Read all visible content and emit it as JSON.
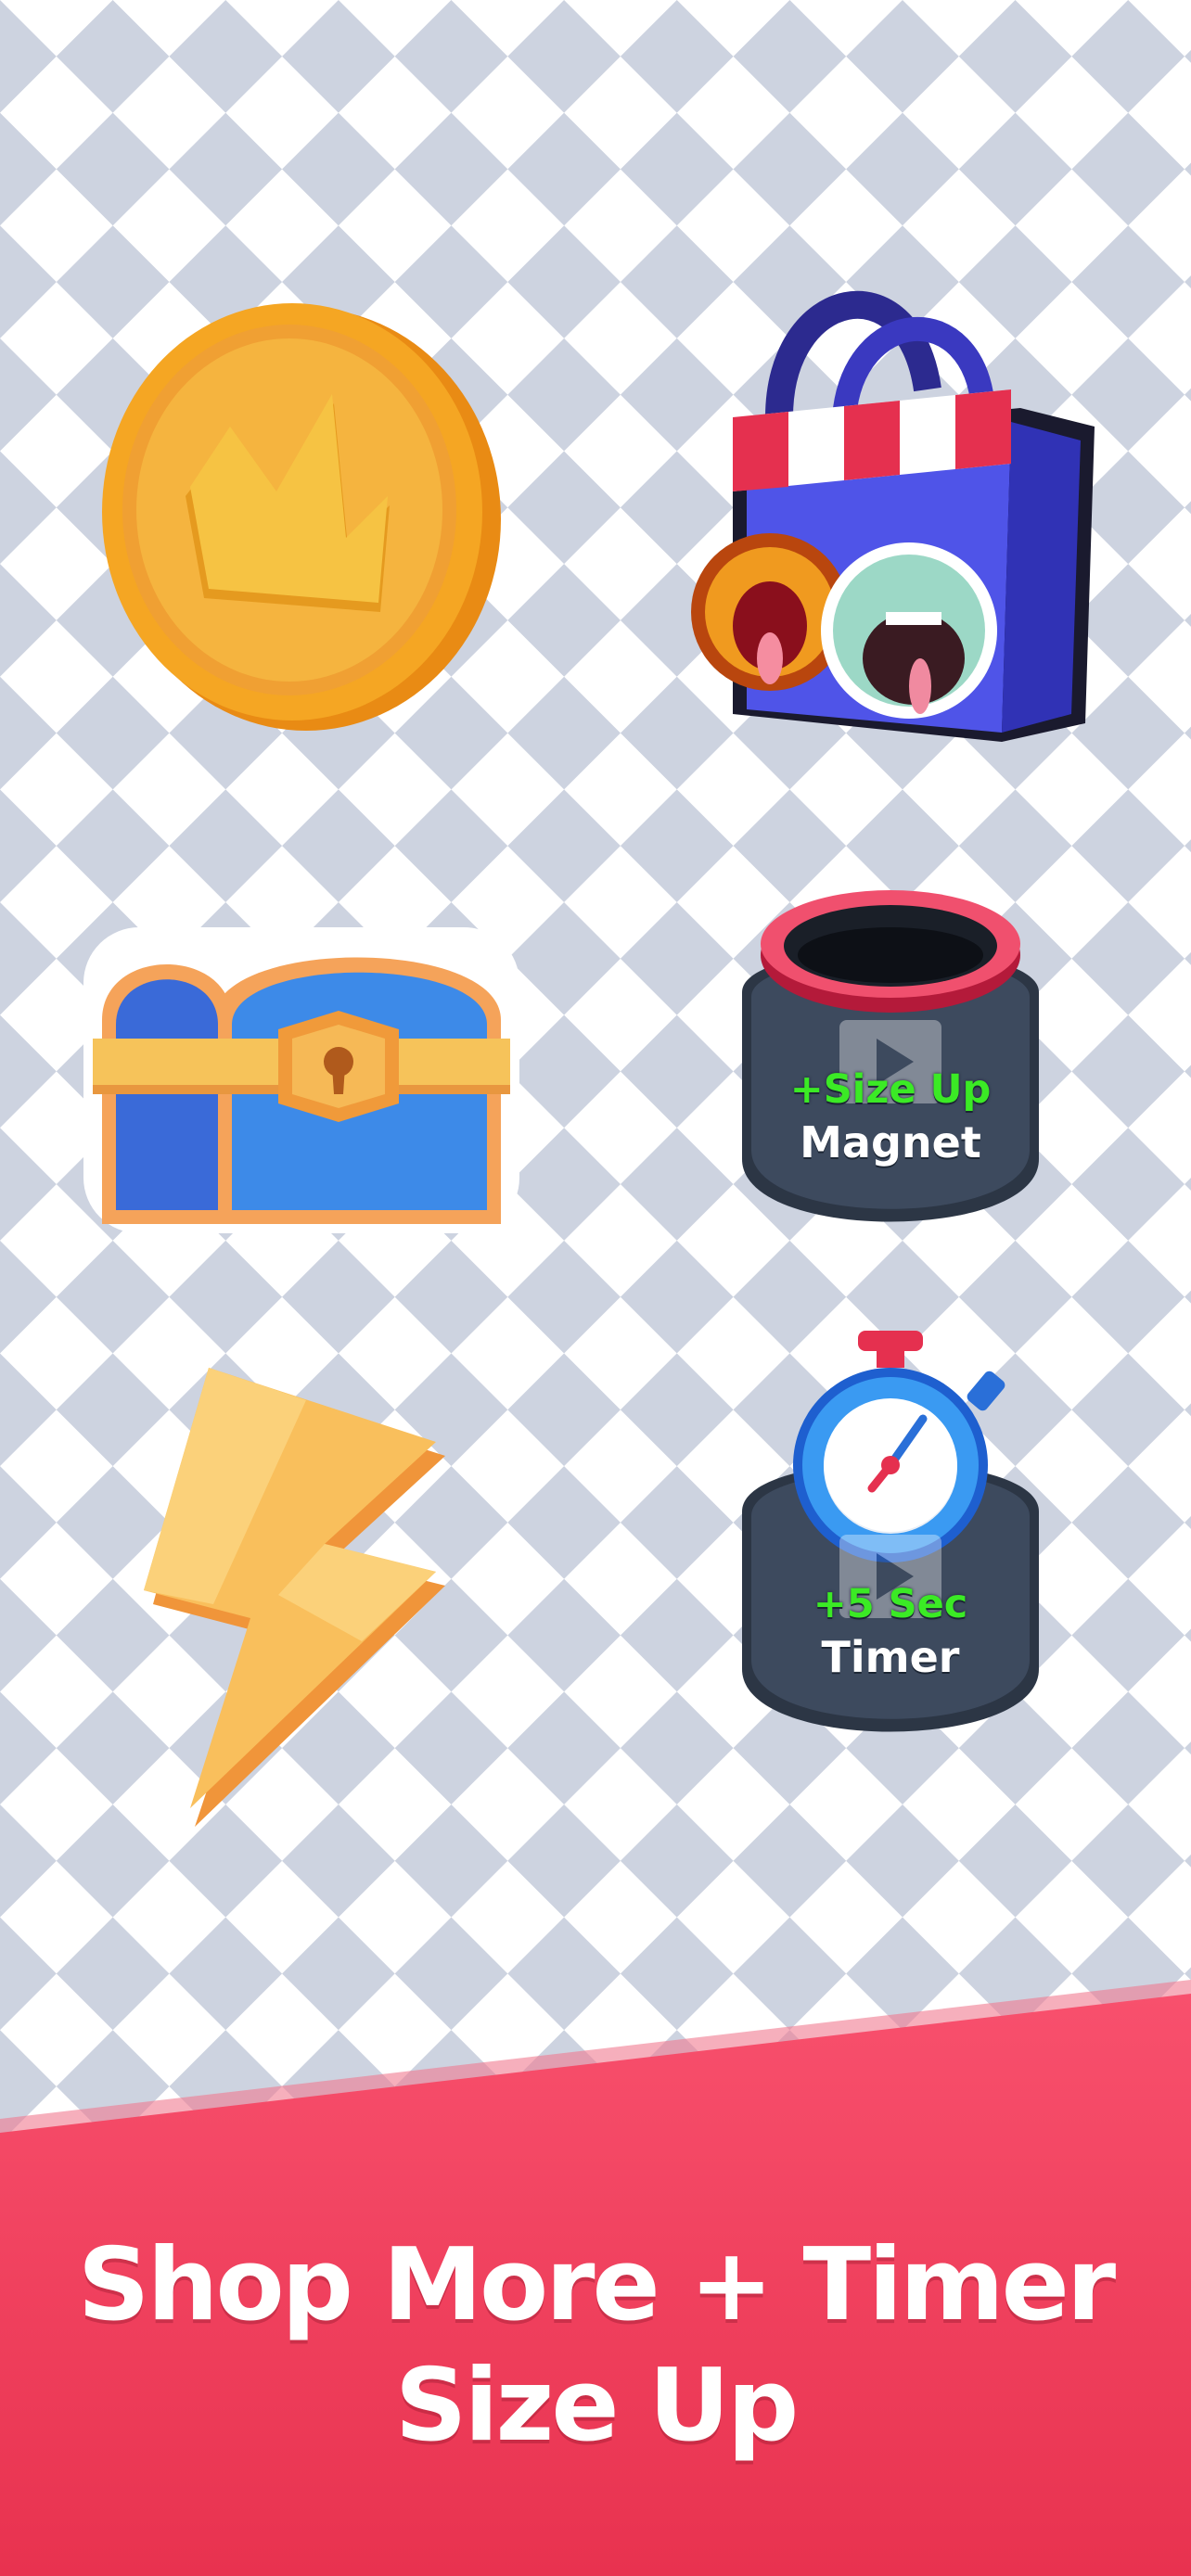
{
  "colors": {
    "checker_light": "#ffffff",
    "checker_dark": "#cdd3e0",
    "banner_top": "#f8506d",
    "banner_bottom": "#e8324f",
    "badge_green": "#3bea25"
  },
  "items": [
    {
      "name": "coin",
      "icon": "crown-coin-icon"
    },
    {
      "name": "shop",
      "icon": "shop-bag-icon"
    },
    {
      "name": "chest",
      "icon": "treasure-chest-icon"
    },
    {
      "name": "magnet",
      "icon": "hole-magnet-icon",
      "line1": "+Size Up",
      "line2": "Magnet",
      "play_icon": "play-icon"
    },
    {
      "name": "bolt",
      "icon": "lightning-bolt-icon"
    },
    {
      "name": "timer",
      "icon": "stopwatch-icon",
      "line1": "+5 Sec",
      "line2": "Timer",
      "play_icon": "play-icon"
    }
  ],
  "caption": {
    "line1": "Shop More + Timer",
    "line2": "Size Up"
  }
}
